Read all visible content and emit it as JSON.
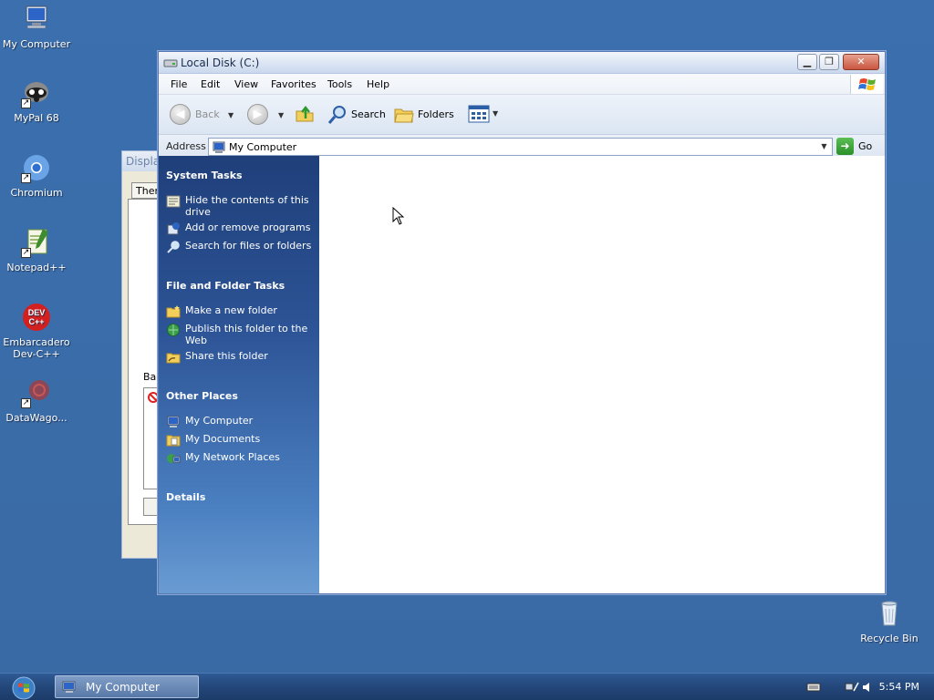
{
  "desktop": {
    "icons": [
      {
        "label": "My Computer",
        "icon": "my-computer-icon"
      },
      {
        "label": "MyPal 68",
        "icon": "mypal-icon"
      },
      {
        "label": "Chromium",
        "icon": "chromium-icon"
      },
      {
        "label": "Notepad++",
        "icon": "notepad-plus-plus-icon"
      },
      {
        "label": "Embarcadero Dev-C++",
        "icon": "dev-cpp-icon"
      },
      {
        "label": "DataWago...",
        "icon": "datawago-icon"
      },
      {
        "label": "Recycle Bin",
        "icon": "recycle-bin-icon"
      }
    ],
    "dev_cpp_badge": "DEV\nC++"
  },
  "background_dialog": {
    "title": "Displa",
    "tab": "Them",
    "label": "Bac"
  },
  "window": {
    "title": "Local Disk (C:)",
    "menu": [
      "File",
      "Edit",
      "View",
      "Favorites",
      "Tools",
      "Help"
    ],
    "toolbar": {
      "back": "Back",
      "search": "Search",
      "folders": "Folders"
    },
    "address": {
      "label": "Address",
      "value": "My Computer",
      "go": "Go"
    },
    "task_pane": {
      "system_tasks": {
        "title": "System Tasks",
        "items": [
          "Hide the contents of this drive",
          "Add or remove programs",
          "Search for files or folders"
        ]
      },
      "file_folder_tasks": {
        "title": "File and Folder Tasks",
        "items": [
          "Make a new folder",
          "Publish this folder to the Web",
          "Share this folder"
        ]
      },
      "other_places": {
        "title": "Other Places",
        "items": [
          "My Computer",
          "My Documents",
          "My Network Places"
        ]
      },
      "details": {
        "title": "Details"
      }
    }
  },
  "taskbar": {
    "button": "My Computer",
    "clock": "5:54 PM"
  },
  "colors": {
    "desktop": "#3a6ea5",
    "task_pane_top": "#1f3f7a",
    "task_pane_bottom": "#6a9bd2",
    "taskbar": "#23477a"
  }
}
